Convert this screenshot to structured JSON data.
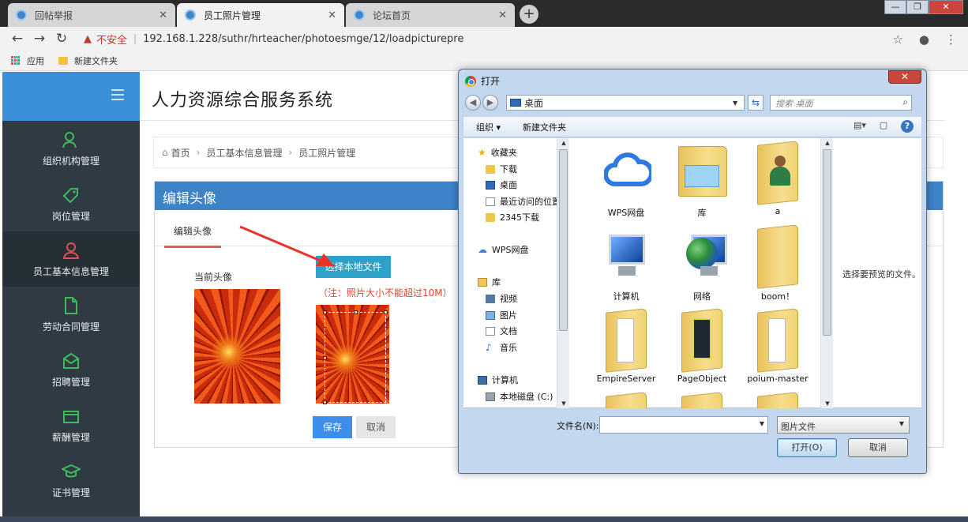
{
  "browser": {
    "tabs": [
      {
        "label": "回帖举报"
      },
      {
        "label": "员工照片管理"
      },
      {
        "label": "论坛首页"
      }
    ],
    "security_label": "不安全",
    "url": "192.168.1.228/suthr/hrteacher/photoesmge/12/loadpicturepre",
    "bookmarks": [
      {
        "label": "应用"
      },
      {
        "label": "新建文件夹"
      }
    ]
  },
  "app": {
    "title": "人力资源综合服务系统",
    "sidebar": [
      {
        "label": "组织机构管理",
        "icon": "org-chart-icon"
      },
      {
        "label": "岗位管理",
        "icon": "tag-icon"
      },
      {
        "label": "员工基本信息管理",
        "icon": "user-icon"
      },
      {
        "label": "劳动合同管理",
        "icon": "document-icon"
      },
      {
        "label": "招聘管理",
        "icon": "envelope-icon"
      },
      {
        "label": "薪酬管理",
        "icon": "wallet-icon"
      },
      {
        "label": "证书管理",
        "icon": "graduation-cap-icon"
      }
    ],
    "breadcrumb": [
      "首页",
      "员工基本信息管理",
      "员工照片管理"
    ],
    "panel": {
      "title": "编辑头像",
      "tab": "编辑头像",
      "current_label": "当前头像",
      "choose_label": "选择本地文件",
      "note": "（注：照片大小不能超过10M）",
      "save_label": "保存",
      "cancel_label": "取消"
    }
  },
  "dialog": {
    "title": "打开",
    "location": "桌面",
    "search_placeholder": "搜索 桌面",
    "toolbar": {
      "organize": "组织",
      "new_folder": "新建文件夹"
    },
    "tree": {
      "favorites": "收藏夹",
      "fav_items": [
        "下载",
        "桌面",
        "最近访问的位置",
        "2345下载"
      ],
      "wps": "WPS网盘",
      "library": "库",
      "lib_items": [
        "视频",
        "图片",
        "文档",
        "音乐"
      ],
      "computer": "计算机",
      "disk": "本地磁盘 (C:)"
    },
    "files": [
      {
        "name": "WPS网盘",
        "icon": "cloud-icon"
      },
      {
        "name": "库",
        "icon": "library-folder-icon"
      },
      {
        "name": "a",
        "icon": "user-folder-icon"
      },
      {
        "name": "计算机",
        "icon": "computer-icon"
      },
      {
        "name": "网络",
        "icon": "network-icon"
      },
      {
        "name": "boom！",
        "icon": "folder-icon"
      },
      {
        "name": "EmpireServer",
        "icon": "folder-icon"
      },
      {
        "name": "PageObject",
        "icon": "folder-icon"
      },
      {
        "name": "poium-master",
        "icon": "folder-icon"
      }
    ],
    "preview_text": "选择要预览的文件。",
    "filename_label": "文件名(N):",
    "filename_value": "",
    "filetype": "图片文件",
    "open_label": "打开(O)",
    "cancel_label": "取消"
  }
}
